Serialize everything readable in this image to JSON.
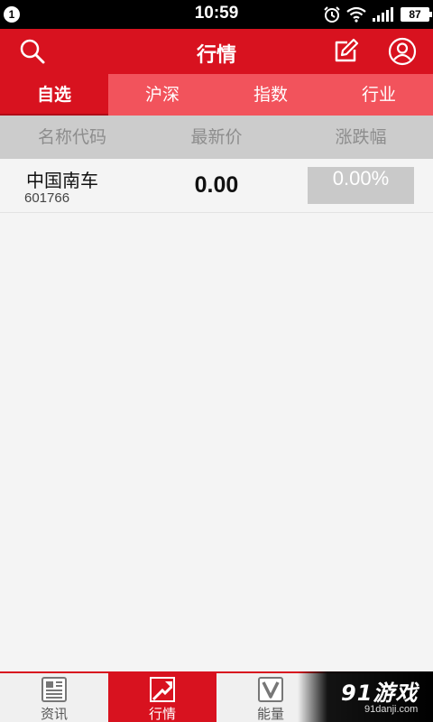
{
  "status_bar": {
    "notification_count": "1",
    "time": "10:59",
    "battery": "87",
    "icons": [
      "alarm-icon",
      "wifi-icon",
      "signal-icon",
      "battery-icon"
    ]
  },
  "header": {
    "title": "行情",
    "icons": [
      "search-icon",
      "edit-icon",
      "user-icon"
    ]
  },
  "tabs": [
    {
      "label": "自选",
      "active": true
    },
    {
      "label": "沪深",
      "active": false
    },
    {
      "label": "指数",
      "active": false
    },
    {
      "label": "行业",
      "active": false
    }
  ],
  "columns": [
    "名称代码",
    "最新价",
    "涨跌幅"
  ],
  "rows": [
    {
      "name": "中国南车",
      "code": "601766",
      "price": "0.00",
      "change": "0.00%"
    }
  ],
  "bottom_nav": [
    {
      "label": "资讯",
      "icon": "news-icon",
      "active": false
    },
    {
      "label": "行情",
      "icon": "trend-icon",
      "active": true
    },
    {
      "label": "能量",
      "icon": "energy-icon",
      "active": false
    }
  ],
  "watermark": {
    "main": "91游戏",
    "sub": "91danji.com"
  },
  "colors": {
    "primary": "#d8121f",
    "tab_bar": "#f2535c",
    "header_row": "#cccccc",
    "flat_change": "#c9c9c9"
  }
}
